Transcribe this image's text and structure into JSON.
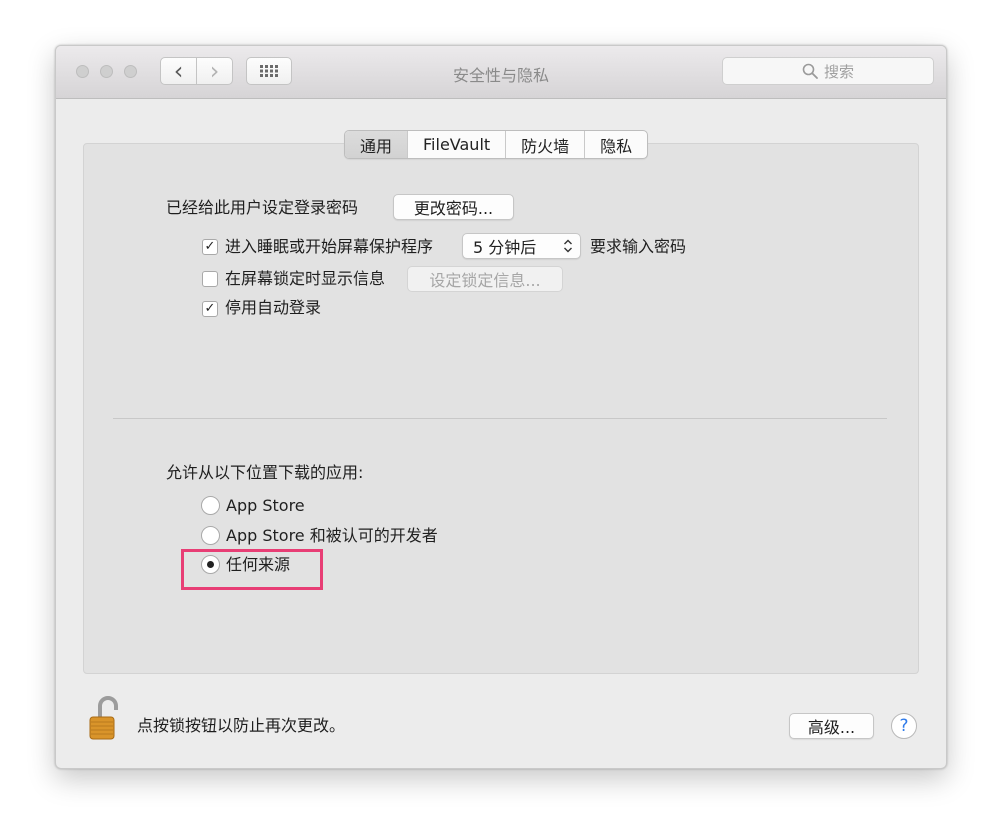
{
  "window": {
    "title": "安全性与隐私",
    "search_placeholder": "搜索",
    "nav_back_glyph": "‹",
    "nav_forward_glyph": "›"
  },
  "tabs": [
    {
      "label": "通用",
      "active": true
    },
    {
      "label": "FileVault",
      "active": false
    },
    {
      "label": "防火墙",
      "active": false
    },
    {
      "label": "隐私",
      "active": false
    }
  ],
  "general": {
    "password_set_label": "已经给此用户设定登录密码",
    "change_password_button": "更改密码...",
    "require_password": {
      "checked": true,
      "label": "进入睡眠或开始屏幕保护程序",
      "select_value": "5 分钟后",
      "suffix": "要求输入密码"
    },
    "show_message": {
      "checked": false,
      "label": "在屏幕锁定时显示信息",
      "button": "设定锁定信息..."
    },
    "disable_autologin": {
      "checked": true,
      "label": "停用自动登录"
    }
  },
  "downloads": {
    "heading": "允许从以下位置下载的应用:",
    "options": [
      {
        "label": "App Store",
        "selected": false
      },
      {
        "label": "App Store 和被认可的开发者",
        "selected": false
      },
      {
        "label": "任何来源",
        "selected": true
      }
    ]
  },
  "footer": {
    "lock_text": "点按锁按钮以防止再次更改。",
    "advanced_button": "高级...",
    "help_glyph": "?"
  },
  "colors": {
    "highlight": "#e83e75",
    "help_accent": "#2f7bea",
    "lock_gold": "#d9942a"
  },
  "icons": {
    "lock": "open-padlock-icon",
    "search": "magnifier-icon",
    "grid": "show-all-grid-icon"
  }
}
